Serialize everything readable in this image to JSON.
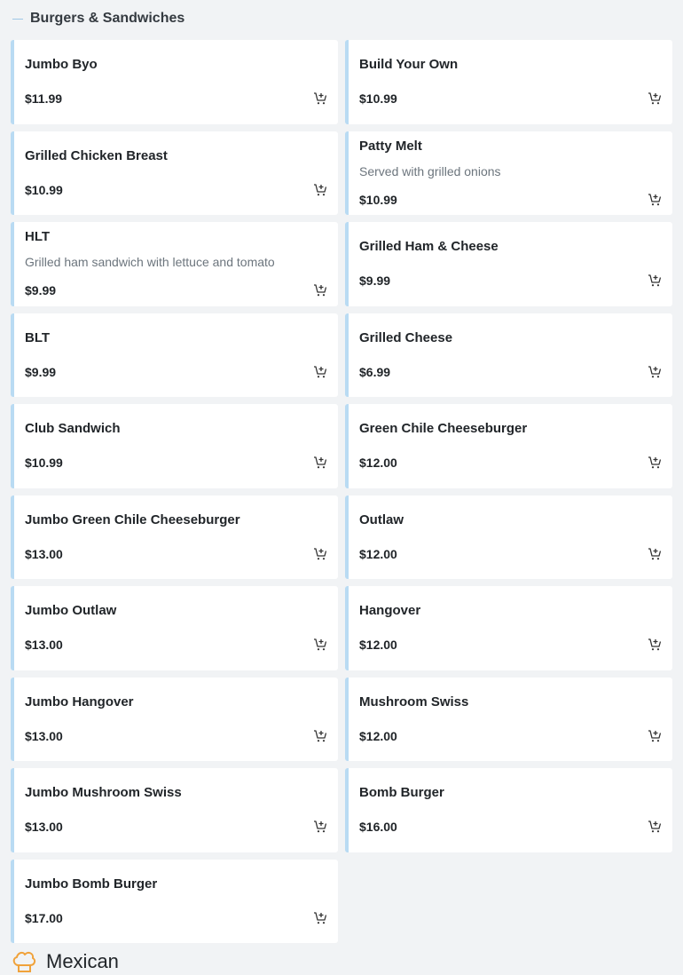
{
  "section": {
    "title": "Burgers & Sandwiches"
  },
  "items": [
    {
      "name": "Jumbo Byo",
      "price": "$11.99"
    },
    {
      "name": "Build Your Own",
      "price": "$10.99"
    },
    {
      "name": "Grilled Chicken Breast",
      "price": "$10.99"
    },
    {
      "name": "Patty Melt",
      "desc": "Served with grilled onions",
      "price": "$10.99"
    },
    {
      "name": "HLT",
      "desc": "Grilled ham sandwich with lettuce and tomato",
      "price": "$9.99"
    },
    {
      "name": "Grilled Ham & Cheese",
      "price": "$9.99"
    },
    {
      "name": "BLT",
      "price": "$9.99"
    },
    {
      "name": "Grilled Cheese",
      "price": "$6.99"
    },
    {
      "name": "Club Sandwich",
      "price": "$10.99"
    },
    {
      "name": "Green Chile Cheeseburger",
      "price": "$12.00"
    },
    {
      "name": "Jumbo Green Chile Cheeseburger",
      "price": "$13.00"
    },
    {
      "name": "Outlaw",
      "price": "$12.00"
    },
    {
      "name": "Jumbo Outlaw",
      "price": "$13.00"
    },
    {
      "name": "Hangover",
      "price": "$12.00"
    },
    {
      "name": "Jumbo Hangover",
      "price": "$13.00"
    },
    {
      "name": "Mushroom Swiss",
      "price": "$12.00"
    },
    {
      "name": "Jumbo Mushroom Swiss",
      "price": "$13.00"
    },
    {
      "name": "Bomb Burger",
      "price": "$16.00"
    },
    {
      "name": "Jumbo Bomb Burger",
      "price": "$17.00"
    }
  ],
  "icons": {
    "add_to_cart": "add-to-cart-icon",
    "next_section": "chef-hat-icon"
  },
  "colors": {
    "card_accent": "#b9dbf3",
    "next_section_icon": "#f0a23b"
  },
  "next_section": {
    "title": "Mexican"
  }
}
